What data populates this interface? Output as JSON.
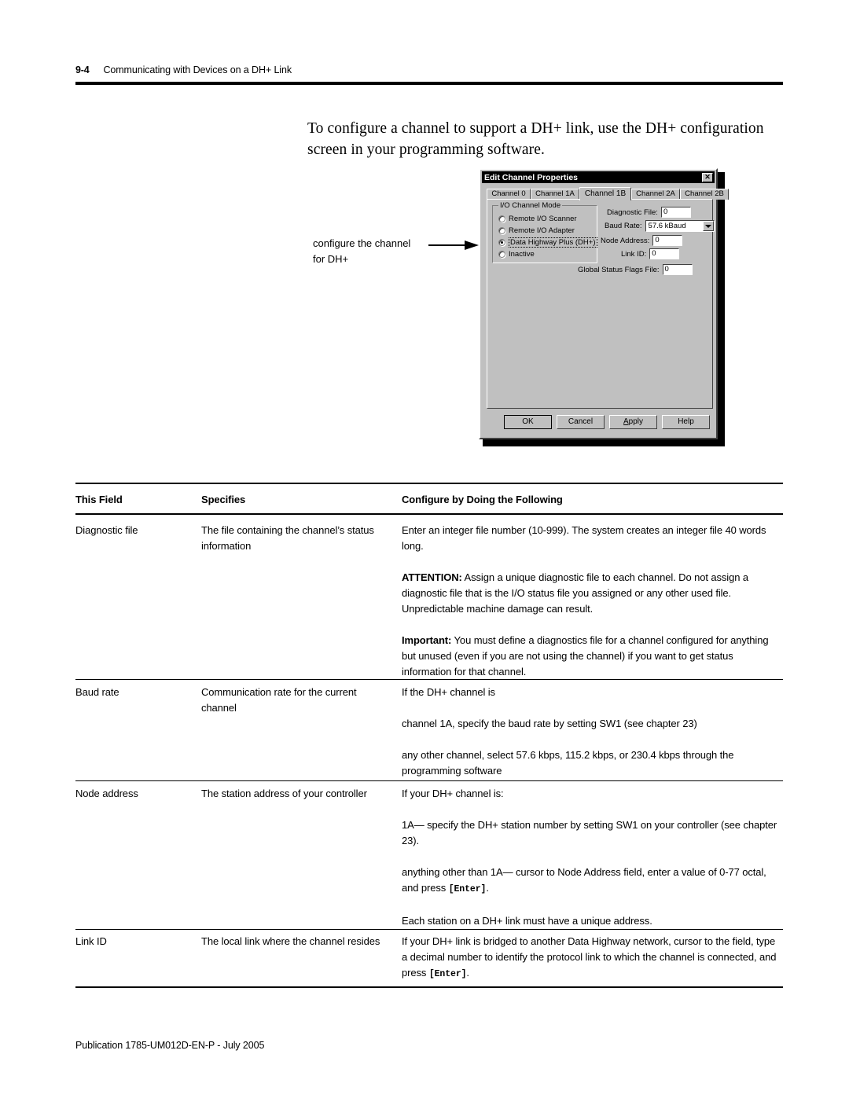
{
  "page": {
    "folio": "9-4",
    "running_head": "Communicating with Devices on a DH+ Link",
    "intro": "To configure a channel to support a DH+ link, use the DH+ configuration screen in your programming software.",
    "footer": "Publication 1785-UM012D-EN-P - July 2005"
  },
  "callout": {
    "line1": "configure the channel",
    "line2": "for DH+"
  },
  "dialog": {
    "title": "Edit Channel Properties",
    "close_label": "✕",
    "tabs": [
      {
        "label": "Channel 0",
        "active": false
      },
      {
        "label": "Channel 1A",
        "active": false
      },
      {
        "label": "Channel 1B",
        "active": true
      },
      {
        "label": "Channel 2A",
        "active": false
      },
      {
        "label": "Channel 2B",
        "active": false
      }
    ],
    "groupbox": {
      "legend": "I/O Channel Mode",
      "options": [
        {
          "label": "Remote I/O Scanner",
          "checked": false,
          "focused": false
        },
        {
          "label": "Remote I/O Adapter",
          "checked": false,
          "focused": false
        },
        {
          "label": "Data Highway Plus (DH+)",
          "checked": true,
          "focused": true
        },
        {
          "label": "Inactive",
          "checked": false,
          "focused": false
        }
      ]
    },
    "fields": {
      "diagnostic_file_label": "Diagnostic File:",
      "diagnostic_file_value": "0",
      "baud_rate_label": "Baud Rate:",
      "baud_rate_value": "57.6 kBaud",
      "node_address_label": "Node Address:",
      "node_address_value": "0",
      "link_id_label": "Link ID:",
      "link_id_value": "0",
      "global_status_label": "Global Status Flags File:",
      "global_status_value": "0"
    },
    "buttons": {
      "ok": "OK",
      "cancel": "Cancel",
      "apply_pre": "A",
      "apply_post": "pply",
      "help": "Help"
    }
  },
  "table": {
    "headers": {
      "field": "This Field",
      "specifies": "Specifies",
      "configure": "Configure by Doing the Following"
    },
    "rows": [
      {
        "field": "Diagnostic file",
        "specifies": "The file containing the channel’s status information",
        "configure_p1": "Enter an integer file number (10-999).  The system creates an integer file 40 words long.",
        "configure_p2_lead": "ATTENTION:",
        "configure_p2": " Assign a unique diagnostic file to each channel.  Do not assign a diagnostic file that is the I/O status file you assigned or any other used file.  Unpredictable machine damage can result.",
        "configure_p3_lead": "Important:",
        "configure_p3": " You must define a diagnostics file for a channel configured for anything but unused (even if you are not using the channel) if you want to get status information for that channel."
      },
      {
        "field": "Baud rate",
        "specifies": "Communication rate for the current channel",
        "configure_p1": "If the DH+ channel is",
        "configure_p2": "channel 1A, specify the baud rate by setting SW1 (see chapter 23)",
        "configure_p3": "any other channel, select 57.6 kbps, 115.2 kbps, or 230.4 kbps through the programming software"
      },
      {
        "field": "Node address",
        "specifies": "The station address of your controller",
        "configure_p1": "If your DH+ channel is:",
        "configure_p2": "1A— specify the DH+ station number by setting SW1 on your controller (see chapter 23).",
        "configure_p3a": "anything other than 1A— cursor to Node Address field, enter a value of 0-77 octal, and press ",
        "configure_p3_kbd": "[Enter]",
        "configure_p3b": ".",
        "configure_p4": "Each station on a DH+ link must have a unique address."
      },
      {
        "field": "Link ID",
        "specifies": "The local link where the channel resides",
        "configure_p1a": "If your DH+ link is bridged to another Data Highway network, cursor to the field, type a decimal number to identify the protocol link to which the channel is connected, and press ",
        "configure_p1_kbd": "[Enter]",
        "configure_p1b": "."
      }
    ]
  }
}
